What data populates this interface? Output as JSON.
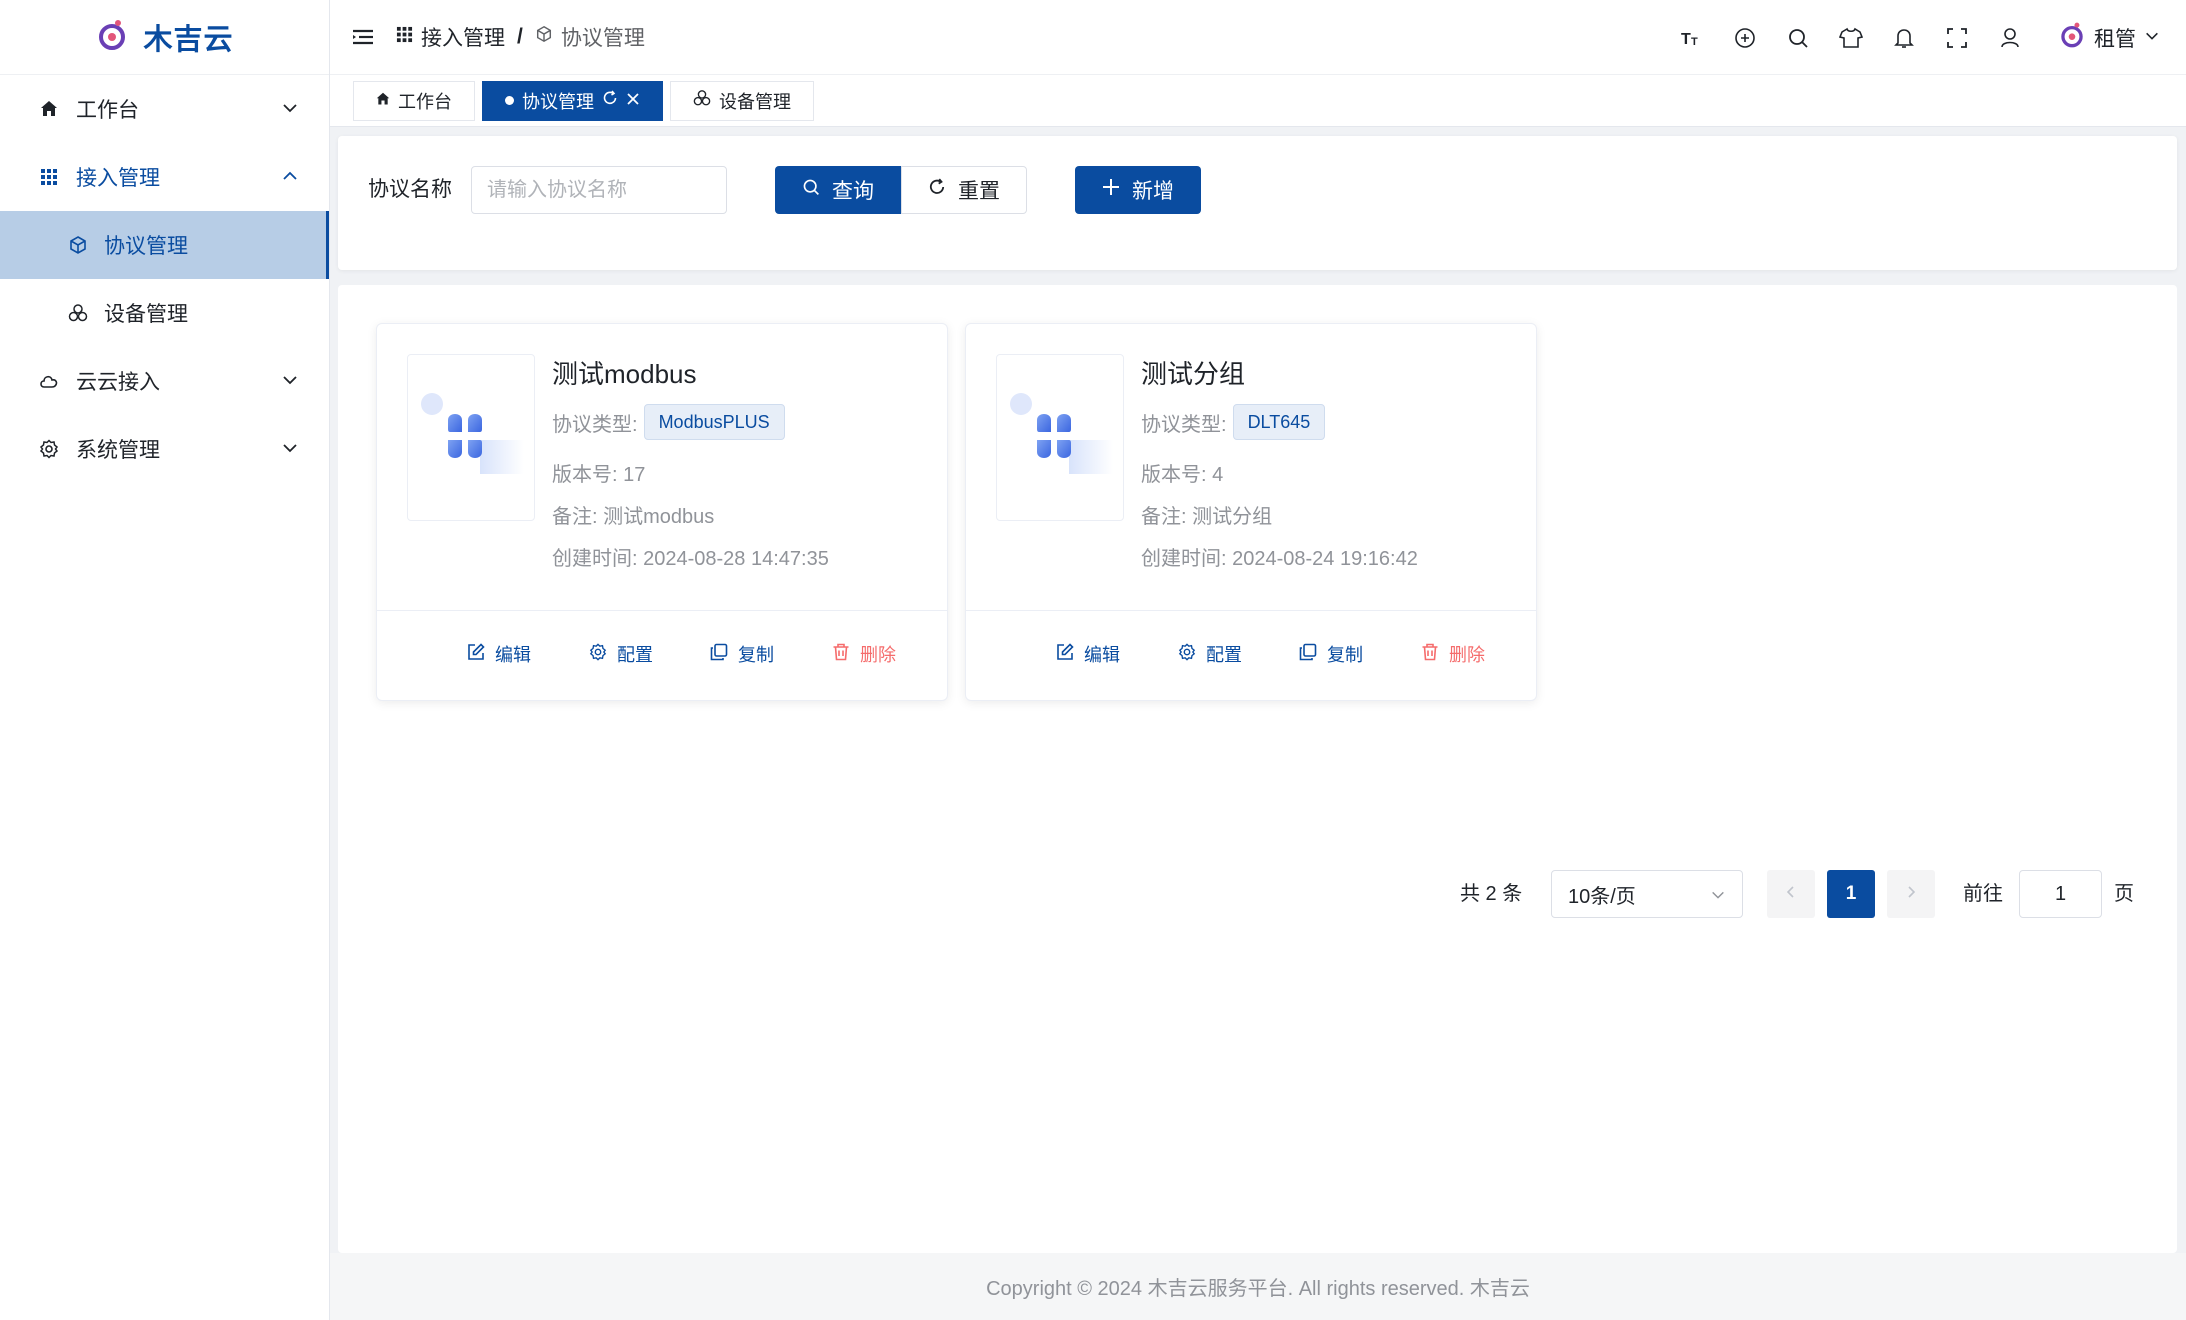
{
  "brand": {
    "name": "木吉云",
    "accent": "#0a4ca0",
    "logo_icon": "brand-logo-icon"
  },
  "sidebar": {
    "items": [
      {
        "label": "工作台",
        "icon": "home-icon"
      },
      {
        "label": "接入管理",
        "icon": "grid-icon",
        "open": true,
        "children": [
          {
            "label": "协议管理",
            "icon": "cube-icon",
            "active": true
          },
          {
            "label": "设备管理",
            "icon": "cluster-icon"
          }
        ]
      },
      {
        "label": "云云接入",
        "icon": "cloud-icon"
      },
      {
        "label": "系统管理",
        "icon": "gear-icon"
      }
    ]
  },
  "header": {
    "breadcrumb": [
      "接入管理",
      "协议管理"
    ],
    "tools": [
      "font-size-icon",
      "language-icon",
      "search-icon",
      "theme-icon",
      "bell-icon",
      "fullscreen-icon",
      "user-icon"
    ],
    "user_name": "租管"
  },
  "tabs": [
    {
      "label": "工作台",
      "icon": "home-icon"
    },
    {
      "label": "协议管理",
      "active": true
    },
    {
      "label": "设备管理",
      "icon": "cluster-icon"
    }
  ],
  "search": {
    "label": "协议名称",
    "placeholder": "请输入协议名称",
    "query_label": "查询",
    "reset_label": "重置",
    "add_label": "新增"
  },
  "cards": [
    {
      "title": "测试modbus",
      "type_label": "协议类型:",
      "type_value": "ModbusPLUS",
      "version": "版本号: 17",
      "remark": "备注: 测试modbus",
      "created": "创建时间: 2024-08-28 14:47:35"
    },
    {
      "title": "测试分组",
      "type_label": "协议类型:",
      "type_value": "DLT645",
      "version": "版本号: 4",
      "remark": "备注: 测试分组",
      "created": "创建时间: 2024-08-24 19:16:42"
    }
  ],
  "card_actions": {
    "edit": "编辑",
    "config": "配置",
    "copy": "复制",
    "delete": "删除"
  },
  "pagination": {
    "total": "共 2 条",
    "page_size": "10条/页",
    "current_page": "1",
    "goto_label": "前往",
    "goto_value": "1",
    "unit": "页"
  },
  "footer": "Copyright © 2024 木吉云服务平台. All rights reserved. 木吉云"
}
